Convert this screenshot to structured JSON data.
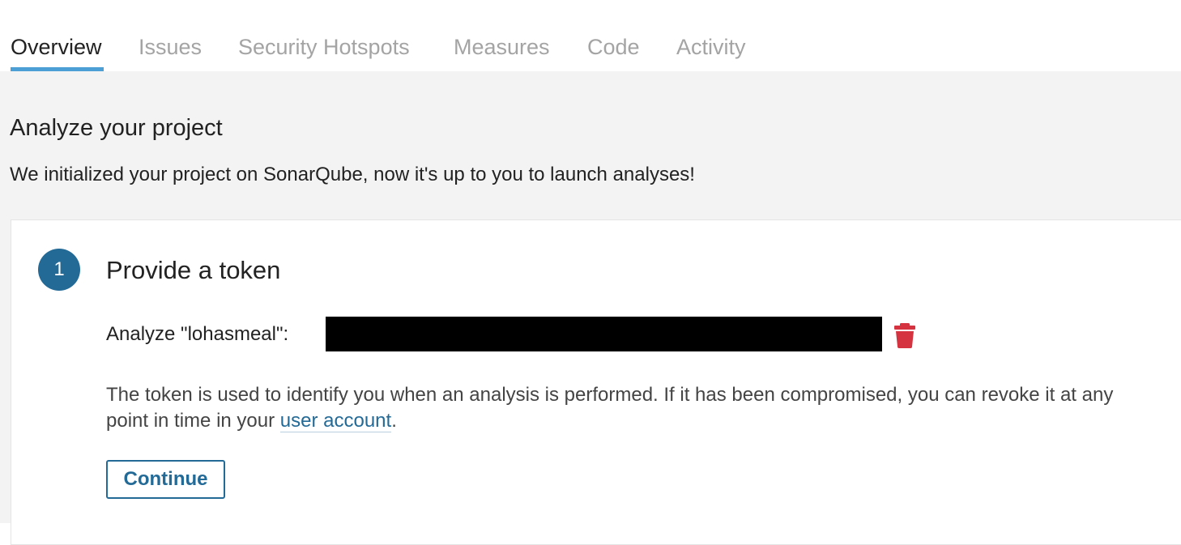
{
  "nav": {
    "tabs": [
      {
        "label": "Overview",
        "active": true
      },
      {
        "label": "Issues",
        "active": false
      },
      {
        "label": "Security Hotspots",
        "active": false
      },
      {
        "label": "Measures",
        "active": false
      },
      {
        "label": "Code",
        "active": false
      },
      {
        "label": "Activity",
        "active": false
      }
    ]
  },
  "main": {
    "title": "Analyze your project",
    "description": "We initialized your project on SonarQube, now it's up to you to launch analyses!"
  },
  "step": {
    "number": "1",
    "title": "Provide a token",
    "token_label": "Analyze \"lohasmeal\":",
    "help_text_before": "The token is used to identify you when an analysis is performed. If it has been compromised, you can revoke it at any point in time in your ",
    "help_link": "user account",
    "help_text_after": ".",
    "continue_label": "Continue"
  },
  "colors": {
    "accent": "#236a97",
    "tab_underline": "#4b9fd5",
    "trash": "#d4333f",
    "content_bg": "#f3f3f3"
  },
  "icons": {
    "delete": "trash-icon"
  }
}
